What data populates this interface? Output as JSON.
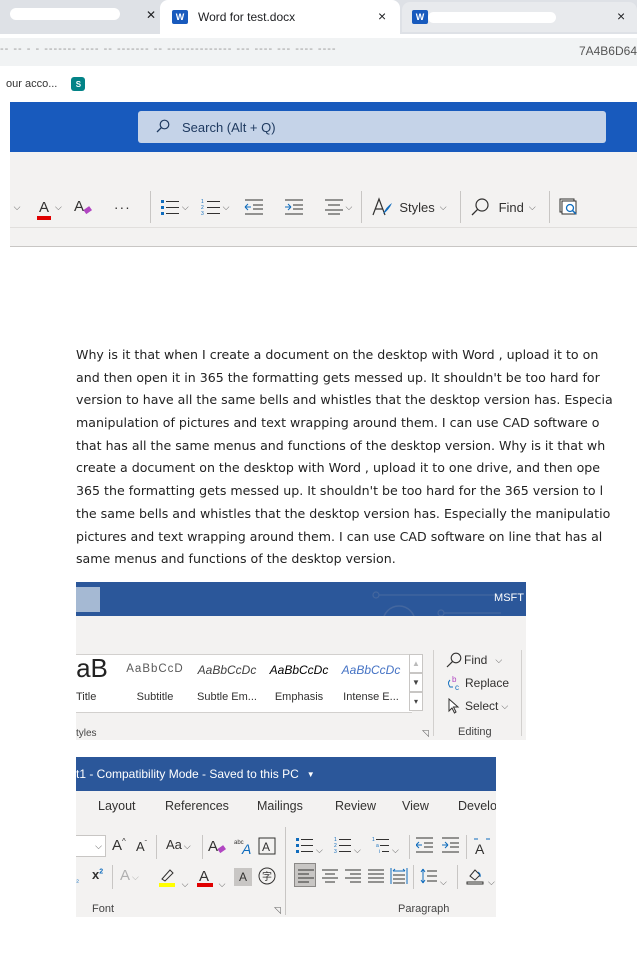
{
  "browser": {
    "tabs": [
      {
        "title": "",
        "blurred": true,
        "active": false
      },
      {
        "title": "Word for test.docx",
        "active": true
      },
      {
        "title": "",
        "blurred": true,
        "active": false
      }
    ],
    "close_glyph": "×",
    "url_tail": "7A4B6D64",
    "bookmark_label": "our acco...",
    "sharepoint_icon_letter": "S"
  },
  "word_online": {
    "search_placeholder": "Search (Alt + Q)",
    "ribbon": {
      "font_color_accent": "#e00000",
      "more_label": "···",
      "styles_label": "Styles",
      "find_label": "Find"
    }
  },
  "document": {
    "lines": [
      "Why is it that when I create a document on the desktop with Word , upload it to on",
      "and then open it in 365 the formatting gets messed up. It shouldn't be too hard for",
      "version to have all the same bells and whistles that the desktop version has. Especia",
      "manipulation of pictures and text wrapping around them. I can use CAD software o",
      "that has all the same menus and functions of the desktop version. Why is it that wh",
      "create a document on the desktop with Word , upload it to one drive, and then ope",
      "365 the formatting gets messed up. It shouldn't be too hard for the 365 version to l",
      "the same bells and whistles that the desktop version has. Especially the manipulatio",
      "pictures and text wrapping around them. I can use CAD software on line that has al",
      "same menus and functions of the desktop version."
    ]
  },
  "desktop_styles_shot": {
    "title_right": "MSFT",
    "gallery": [
      {
        "preview": "aB",
        "label": "Title"
      },
      {
        "preview": "AaBbCcD",
        "label": "Subtitle"
      },
      {
        "preview": "AaBbCcDc",
        "label": "Subtle Em..."
      },
      {
        "preview": "AaBbCcDc",
        "label": "Emphasis"
      },
      {
        "preview": "AaBbCcDc",
        "label": "Intense E..."
      }
    ],
    "group_label": "tyles",
    "editing": {
      "find": "Find",
      "replace": "Replace",
      "select": "Select",
      "group_label": "Editing"
    }
  },
  "desktop_font_shot": {
    "title": "t1  -  Compatibility Mode  -  Saved to this PC",
    "menu_tabs": [
      "Layout",
      "References",
      "Mailings",
      "Review",
      "View",
      "Develo"
    ],
    "font_group_label": "Font",
    "paragraph_group_label": "Paragraph",
    "highlight_color": "#ffff00",
    "font_color": "#e00000"
  }
}
